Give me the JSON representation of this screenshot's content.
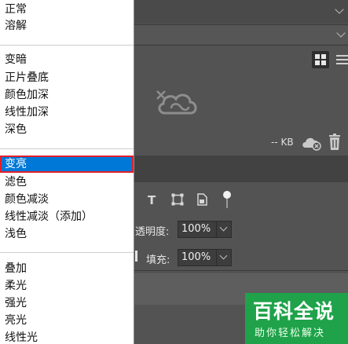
{
  "blend_menu": {
    "items": [
      {
        "label": "正常"
      },
      {
        "label": "溶解"
      },
      {
        "label": "变暗"
      },
      {
        "label": "正片叠底"
      },
      {
        "label": "颜色加深"
      },
      {
        "label": "线性加深"
      },
      {
        "label": "深色"
      },
      {
        "label": "变亮",
        "selected": true
      },
      {
        "label": "滤色"
      },
      {
        "label": "颜色减淡"
      },
      {
        "label": "线性减淡（添加）"
      },
      {
        "label": "浅色"
      },
      {
        "label": "叠加"
      },
      {
        "label": "柔光"
      },
      {
        "label": "强光"
      },
      {
        "label": "亮光"
      },
      {
        "label": "线性光"
      }
    ]
  },
  "library": {
    "size_text": "-- KB"
  },
  "layers": {
    "opacity_label": "透明度:",
    "opacity_value": "100%",
    "fill_label": "填充:",
    "fill_value": "100%"
  },
  "tools": {
    "type_icon": "T"
  },
  "watermark": {
    "title": "百科全说",
    "subtitle": "助你轻松解决"
  },
  "colors": {
    "selection": "#0078d7",
    "highlight_border": "#e0212b",
    "watermark_bg": "#1fa24a"
  }
}
